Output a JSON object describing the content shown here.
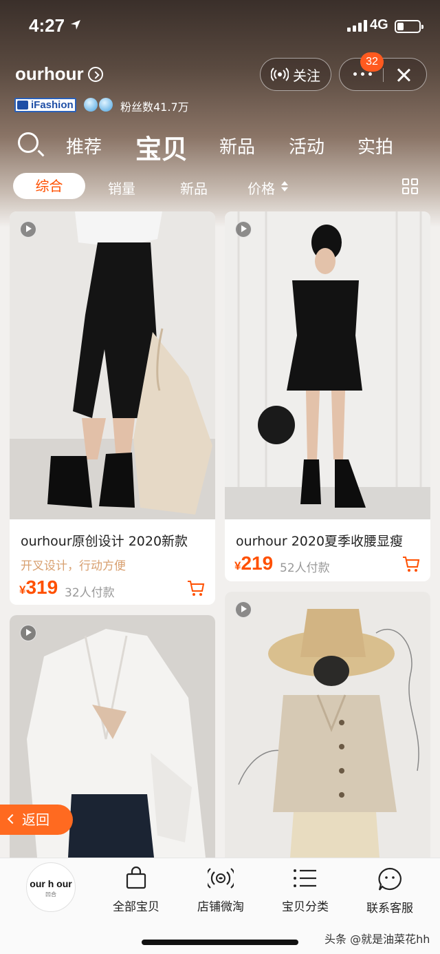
{
  "status_bar": {
    "time": "4:27",
    "network": "4G"
  },
  "shop": {
    "name": "ourhour",
    "brand_badge": "iFashion",
    "fans": "粉丝数41.7万",
    "follow_label": "关注",
    "message_count": "32"
  },
  "nav_tabs": [
    "推荐",
    "宝贝",
    "新品",
    "活动",
    "实拍"
  ],
  "sort_tabs": [
    "综合",
    "销量",
    "新品",
    "价格"
  ],
  "products": [
    {
      "title": "ourhour原创设计 2020新款",
      "subtitle": "开叉设计，行动方便",
      "currency": "¥",
      "price": "319",
      "sold": "32人付款"
    },
    {
      "title": "ourhour 2020夏季收腰显瘦",
      "subtitle": "",
      "currency": "¥",
      "price": "219",
      "sold": "52人付款"
    },
    {
      "title": "",
      "subtitle": "",
      "currency": "",
      "price": "",
      "sold": ""
    },
    {
      "title": "",
      "subtitle": "",
      "currency": "",
      "price": "",
      "sold": ""
    }
  ],
  "back_label": "返回",
  "bottom_nav": {
    "logo_text": "our h our",
    "logo_sub": "凹合",
    "items": [
      "全部宝贝",
      "店铺微淘",
      "宝贝分类",
      "联系客服"
    ]
  },
  "watermark": "头条 @就是油菜花hh",
  "colors": {
    "accent": "#ff5000",
    "back_button": "#ff6a20",
    "header_dark": "#3a2f2a"
  }
}
